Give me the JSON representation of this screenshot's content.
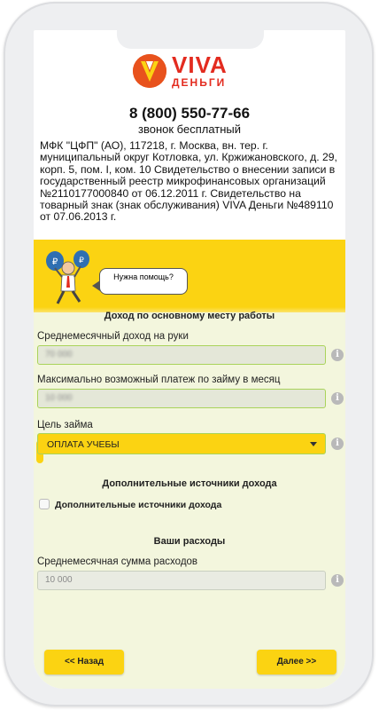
{
  "brand": {
    "name": "VIVA",
    "sub": "ДЕНЬГИ"
  },
  "contact": {
    "phone": "8 (800) 550-77-66",
    "phone_note": "звонок бесплатный"
  },
  "legal": {
    "text": "МФК \"ЦФП\" (АО), 117218, г. Москва, вн. тер. г. муниципальный округ Котловка, ул. Кржижановского, д. 29, корп. 5, пом. I, ком. 10 Свидетельство о внесении записи в государственный реестр микрофинансовых организаций №2110177000840 от 06.12.2011 г. Свидетельство на товарный знак (знак обслуживания) VIVA Деньги №489110 от 07.06.2013 г."
  },
  "help": {
    "bubble": "Нужна помощь?"
  },
  "income_section": {
    "title": "Доход по основному месту работы",
    "monthly_income_label": "Среднемесячный доход на руки",
    "monthly_income_value": "70 000",
    "max_payment_label": "Максимально возможный платеж по займу в месяц",
    "max_payment_value": "10 000",
    "loan_purpose_label": "Цель займа",
    "loan_purpose_value": "ОПЛАТА УЧЕБЫ"
  },
  "extra_section": {
    "title": "Дополнительные источники дохода",
    "checkbox_label": "Дополнительные источники дохода"
  },
  "expenses_section": {
    "title": "Ваши расходы",
    "monthly_expenses_label": "Среднемесячная сумма расходов",
    "monthly_expenses_value": "10 000"
  },
  "nav": {
    "back": "<< Назад",
    "next": "Далее >>"
  },
  "icons": {
    "info": "info-icon",
    "logo": "viva-logo-icon",
    "mascot": "mascot-with-money-bags"
  },
  "colors": {
    "brand_red": "#e32b1f",
    "accent_yellow": "#fbd312",
    "form_bg": "#f3f6dd",
    "field_border": "#a9d35a"
  }
}
